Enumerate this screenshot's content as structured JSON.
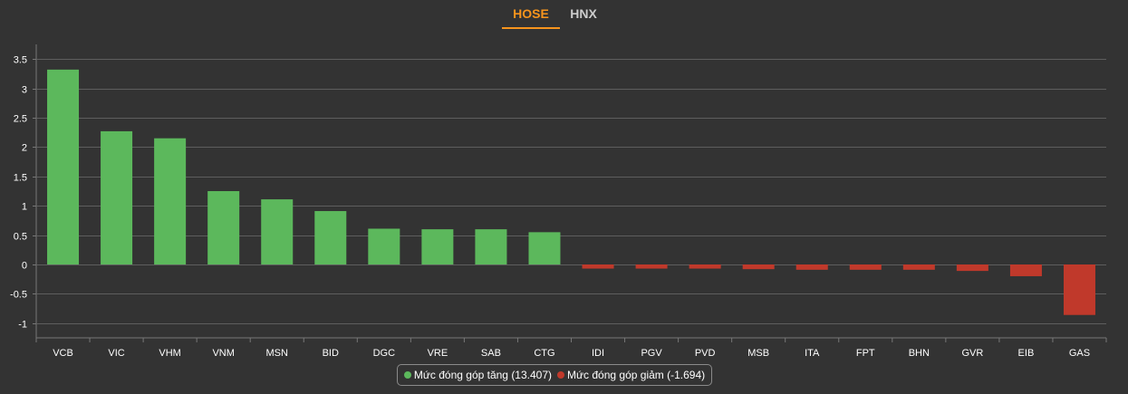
{
  "tabs": {
    "hose_label": "HOSE",
    "hnx_label": "HNX"
  },
  "legend": {
    "increase_label": "Mức đóng góp tăng (13.407)",
    "decrease_label": "Mức đóng góp giảm (-1.694)"
  },
  "colors": {
    "increase": "#5cb85c",
    "decrease": "#c0392b",
    "active_tab": "#f7941d",
    "background": "#333333"
  },
  "chart_data": {
    "type": "bar",
    "categories": [
      "VCB",
      "VIC",
      "VHM",
      "VNM",
      "MSN",
      "BID",
      "DGC",
      "VRE",
      "SAB",
      "CTG",
      "IDI",
      "PGV",
      "PVD",
      "MSB",
      "ITA",
      "FPT",
      "BHN",
      "GVR",
      "EIB",
      "GAS"
    ],
    "values": [
      3.32,
      2.27,
      2.15,
      1.25,
      1.11,
      0.91,
      0.61,
      0.6,
      0.6,
      0.55,
      -0.07,
      -0.07,
      -0.07,
      -0.08,
      -0.09,
      -0.09,
      -0.09,
      -0.11,
      -0.2,
      -0.86
    ],
    "series": [
      {
        "name": "Mức đóng góp tăng (13.407)"
      },
      {
        "name": "Mức đóng góp giảm (-1.694)"
      }
    ],
    "ylim": [
      -1.25,
      3.75
    ],
    "yticks": [
      "3.5",
      "3",
      "2.5",
      "2",
      "1.5",
      "1",
      "0.5",
      "0",
      "-0.5",
      "-1"
    ],
    "grid": true,
    "legend_position": "bottom"
  }
}
